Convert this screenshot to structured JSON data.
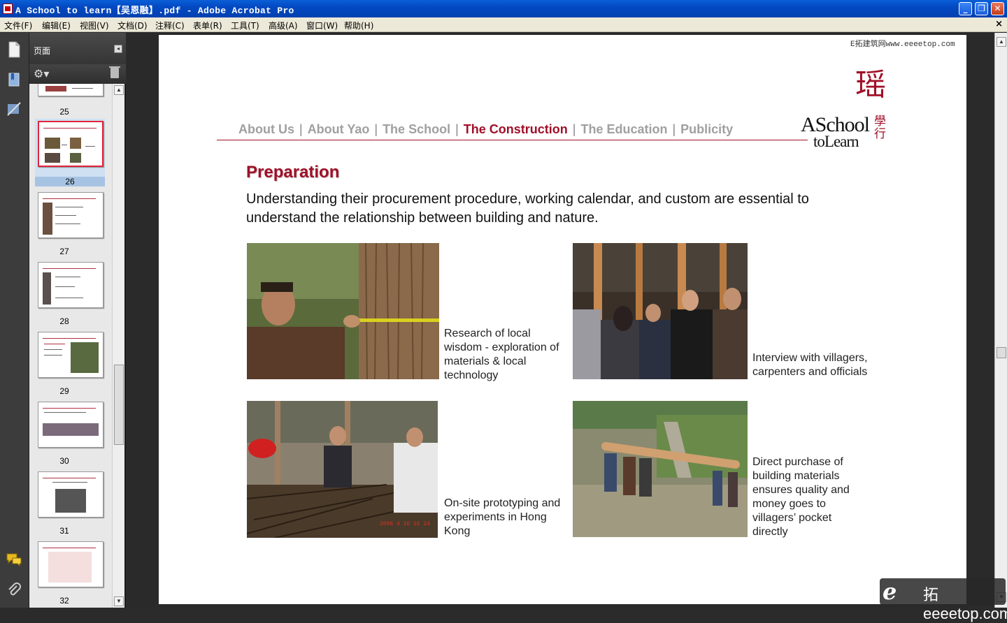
{
  "window": {
    "title": "A School to learn【吴恩融】.pdf - Adobe Acrobat Pro",
    "minimize": "_",
    "restore": "❐",
    "close": "✕"
  },
  "menu": {
    "items": [
      "文件(F)",
      "编辑(E)",
      "视图(V)",
      "文档(D)",
      "注释(C)",
      "表单(R)",
      "工具(T)",
      "高级(A)",
      "窗口(W)",
      "帮助(H)"
    ],
    "close_doc": "×"
  },
  "panel": {
    "title": "页面",
    "pages": [
      "25",
      "26",
      "27",
      "28",
      "29",
      "30",
      "31",
      "32"
    ],
    "selected_page": "26"
  },
  "page": {
    "watermark_top": "E拓建筑网www.eeeetop.com",
    "nav": {
      "items": [
        "About Us",
        "About Yao",
        "The School",
        "The Construction",
        "The Education",
        "Publicity"
      ],
      "separator": "|",
      "active": "The Construction"
    },
    "logo": {
      "line1": "ASchool",
      "line2": "toLearn",
      "cn_big": "瑶",
      "cn_small": "學行"
    },
    "heading": "Preparation",
    "intro": "Understanding their procurement procedure, working calendar, and custom are essential to understand the relationship between building and nature.",
    "photos": [
      {
        "caption": "Research of local wisdom - exploration of materials & local technology"
      },
      {
        "caption": "Interview with villagers, carpenters and officials"
      },
      {
        "caption": "On-site prototyping and experiments in Hong Kong"
      },
      {
        "caption": "Direct purchase of building materials ensures quality and money goes to villagers’ pocket directly"
      }
    ]
  },
  "watermark_bottom": {
    "e": "e",
    "text": "拓eeeetop.com"
  },
  "colors": {
    "accent": "#a01028",
    "nav_inactive": "#a0a0a0",
    "titlebar": "#0349c2"
  }
}
